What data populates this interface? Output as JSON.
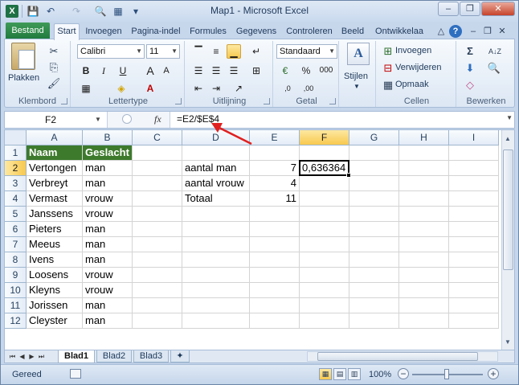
{
  "window": {
    "title": "Map1 - Microsoft Excel",
    "logo": "X",
    "controls": {
      "minimize": "–",
      "restore": "❐",
      "close": "✕"
    }
  },
  "qat": {
    "save_icon": "💾",
    "undo_icon": "↶",
    "redo_icon": "↷",
    "print_preview_icon": "🔍",
    "view_icon": "▦",
    "customize_icon": "▾"
  },
  "tabs": {
    "file": "Bestand",
    "items": [
      "Start",
      "Invoegen",
      "Pagina-indel",
      "Formules",
      "Gegevens",
      "Controleren",
      "Beeld",
      "Ontwikkelaa"
    ]
  },
  "ribbon": {
    "clipboard": {
      "label": "Klembord",
      "paste": "Plakken",
      "cut_icon": "✂",
      "copy_icon": "⎘",
      "format_painter_icon": "🖌"
    },
    "font": {
      "label": "Lettertype",
      "font_name": "Calibri",
      "font_size": "11",
      "bold": "B",
      "italic": "I",
      "underline": "U",
      "grow": "A",
      "shrink": "A",
      "border_icon": "▦",
      "fill_icon": "◈",
      "color": "A"
    },
    "alignment": {
      "label": "Uitlijning"
    },
    "number": {
      "label": "Getal",
      "format": "Standaard",
      "percent": "%",
      "thousands": "000",
      "inc_decimal": ",0",
      "dec_decimal": ",00",
      "currency_icon": "€"
    },
    "styles": {
      "label": "Stijlen"
    },
    "cells": {
      "label": "Cellen",
      "insert": "Invoegen",
      "delete": "Verwijderen",
      "format": "Opmaak"
    },
    "editing": {
      "label": "Bewerken",
      "sum_icon": "Σ",
      "sort_icon": "A↓Z",
      "fill_icon": "⬇",
      "find_icon": "🔍",
      "clear_icon": "◇"
    }
  },
  "formula_bar": {
    "name_box": "F2",
    "fx": "fx",
    "formula": "=E2/$E$4"
  },
  "grid": {
    "columns": [
      "A",
      "B",
      "C",
      "D",
      "E",
      "F",
      "G",
      "H",
      "I"
    ],
    "rows": [
      "1",
      "2",
      "3",
      "4",
      "5",
      "6",
      "7",
      "8",
      "9",
      "10",
      "11",
      "12"
    ],
    "selected_column": "F",
    "selected_row": "2",
    "cells": {
      "A1": "Naam",
      "B1": "Geslacht",
      "A2": "Vertongen",
      "B2": "man",
      "D2": "aantal man",
      "E2": "7",
      "F2": "0,636364",
      "A3": "Verbreyt",
      "B3": "man",
      "D3": "aantal vrouw",
      "E3": "4",
      "A4": "Vermast",
      "B4": "vrouw",
      "D4": "Totaal",
      "E4": "11",
      "A5": "Janssens",
      "B5": "vrouw",
      "A6": "Pieters",
      "B6": "man",
      "A7": "Meeus",
      "B7": "man",
      "A8": "Ivens",
      "B8": "man",
      "A9": "Loosens",
      "B9": "vrouw",
      "A10": "Kleyns",
      "B10": "vrouw",
      "A11": "Jorissen",
      "B11": "man",
      "A12": "Cleyster",
      "B12": "man"
    }
  },
  "sheets": {
    "nav": [
      "⏮",
      "◀",
      "▶",
      "⏭"
    ],
    "items": [
      "Blad1",
      "Blad2",
      "Blad3"
    ],
    "active": "Blad1"
  },
  "status": {
    "ready": "Gereed",
    "zoom": "100%",
    "zoom_minus": "−",
    "zoom_plus": "+"
  },
  "colors": {
    "header_fill": "#3d7a2c",
    "file_tab": "#1f7a3c",
    "annotation_arrow": "#e02020"
  }
}
